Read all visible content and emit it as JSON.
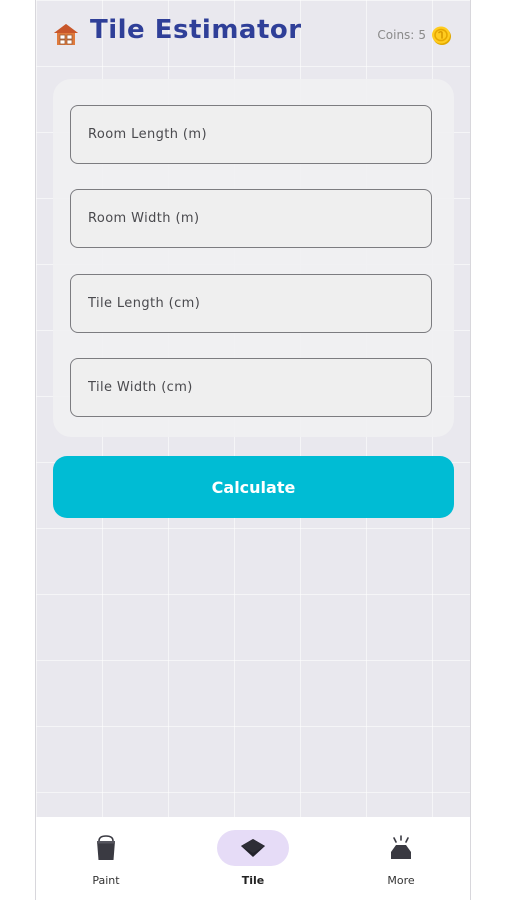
{
  "header": {
    "title": "Tile Estimator",
    "logo_icon": "house-tiles-icon",
    "coins_label": "Coins:",
    "coins_value": "5",
    "coin_icon": "gold-coin-icon"
  },
  "form": {
    "fields": [
      {
        "placeholder": "Room Length (m)",
        "value": ""
      },
      {
        "placeholder": "Room Width (m)",
        "value": ""
      },
      {
        "placeholder": "Tile Length (cm)",
        "value": ""
      },
      {
        "placeholder": "Tile Width (cm)",
        "value": ""
      }
    ],
    "submit_label": "Calculate"
  },
  "nav": {
    "items": [
      {
        "label": "Paint",
        "icon": "paint-bucket-icon",
        "active": false
      },
      {
        "label": "Tile",
        "icon": "tile-icon",
        "active": true
      },
      {
        "label": "More",
        "icon": "more-icon",
        "active": false
      }
    ]
  },
  "colors": {
    "title": "#2f3f98",
    "primary_button": "#00bcd4",
    "active_nav_pill": "#e6dcf7",
    "background": "#e9e8ee"
  }
}
